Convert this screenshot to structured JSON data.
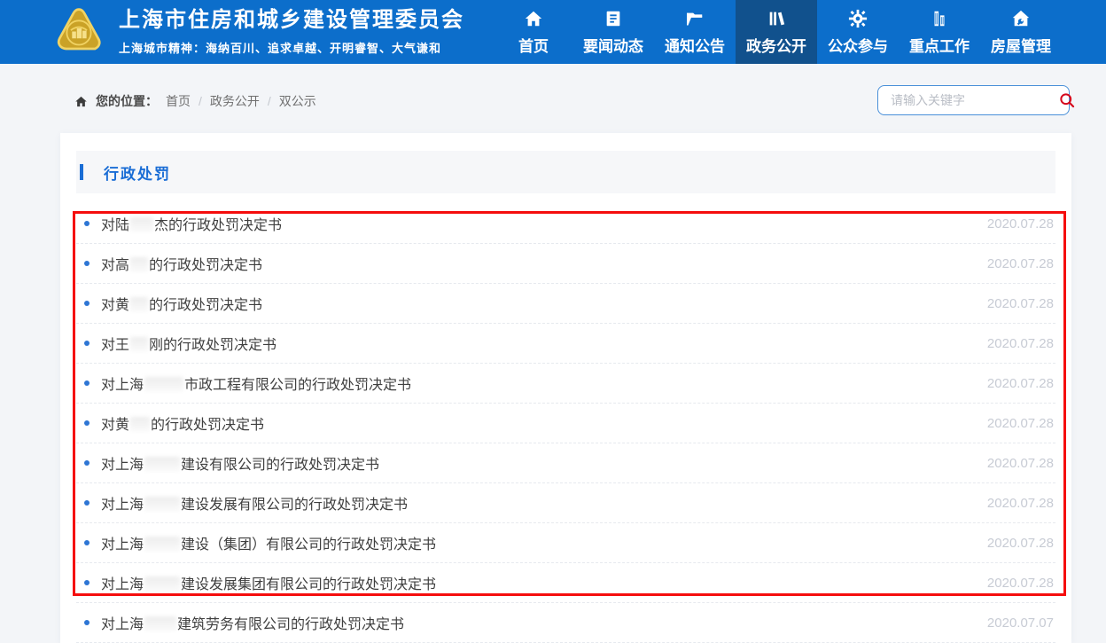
{
  "header": {
    "site_title": "上海市住房和城乡建设管理委员会",
    "site_subtitle": "上海城市精神：海纳百川、追求卓越、开明睿智、大气谦和",
    "nav": [
      {
        "label": "首页",
        "icon": "home-icon",
        "active": false
      },
      {
        "label": "要闻动态",
        "icon": "news-icon",
        "active": false
      },
      {
        "label": "通知公告",
        "icon": "folder-icon",
        "active": false
      },
      {
        "label": "政务公开",
        "icon": "books-icon",
        "active": true
      },
      {
        "label": "公众参与",
        "icon": "gear-icon",
        "active": false
      },
      {
        "label": "重点工作",
        "icon": "building-icon",
        "active": false
      },
      {
        "label": "房屋管理",
        "icon": "house-tools-icon",
        "active": false
      }
    ]
  },
  "breadcrumb": {
    "label": "您的位置：",
    "separator": "/",
    "items": [
      "首页",
      "政务公开",
      "双公示"
    ]
  },
  "search": {
    "placeholder": "请输入关键字",
    "icon": "search-icon"
  },
  "section": {
    "title": "行政处罚"
  },
  "list": [
    {
      "prefix": "对陆",
      "redacted": true,
      "blur_width": 26,
      "suffix": "杰的行政处罚决定书",
      "date": "2020.07.28"
    },
    {
      "prefix": "对高",
      "redacted": true,
      "blur_width": 20,
      "suffix": "的行政处罚决定书",
      "date": "2020.07.28"
    },
    {
      "prefix": "对黄",
      "redacted": true,
      "blur_width": 20,
      "suffix": "的行政处罚决定书",
      "date": "2020.07.28"
    },
    {
      "prefix": "对王",
      "redacted": true,
      "blur_width": 20,
      "suffix": "刚的行政处罚决定书",
      "date": "2020.07.28"
    },
    {
      "prefix": "对上海",
      "redacted": true,
      "blur_width": 44,
      "suffix": "市政工程有限公司的行政处罚决定书",
      "date": "2020.07.28"
    },
    {
      "prefix": "对黄",
      "redacted": true,
      "blur_width": 22,
      "suffix": "的行政处罚决定书",
      "date": "2020.07.28"
    },
    {
      "prefix": "对上海",
      "redacted": true,
      "blur_width": 40,
      "suffix": "建设有限公司的行政处罚决定书",
      "date": "2020.07.28"
    },
    {
      "prefix": "对上海",
      "redacted": true,
      "blur_width": 40,
      "suffix": "建设发展有限公司的行政处罚决定书",
      "date": "2020.07.28"
    },
    {
      "prefix": "对上海",
      "redacted": true,
      "blur_width": 40,
      "suffix": "建设（集团）有限公司的行政处罚决定书",
      "date": "2020.07.28"
    },
    {
      "prefix": "对上海",
      "redacted": true,
      "blur_width": 40,
      "suffix": "建设发展集团有限公司的行政处罚决定书",
      "date": "2020.07.28"
    },
    {
      "prefix": "对上海",
      "redacted": true,
      "blur_width": 36,
      "suffix": "建筑劳务有限公司的行政处罚决定书",
      "date": "2020.07.07"
    }
  ],
  "colors": {
    "header_bg": "#0c6ecb",
    "active_tab_bg": "#11518d",
    "page_bg": "#f3f5f8",
    "section_accent": "#1a6dd5",
    "bullet_blue": "#2d75d4",
    "date_gray": "#c7cbd4",
    "annotation_red": "#f50d0d",
    "search_border": "#4a90d9",
    "logo_gold": "#e6c244"
  }
}
